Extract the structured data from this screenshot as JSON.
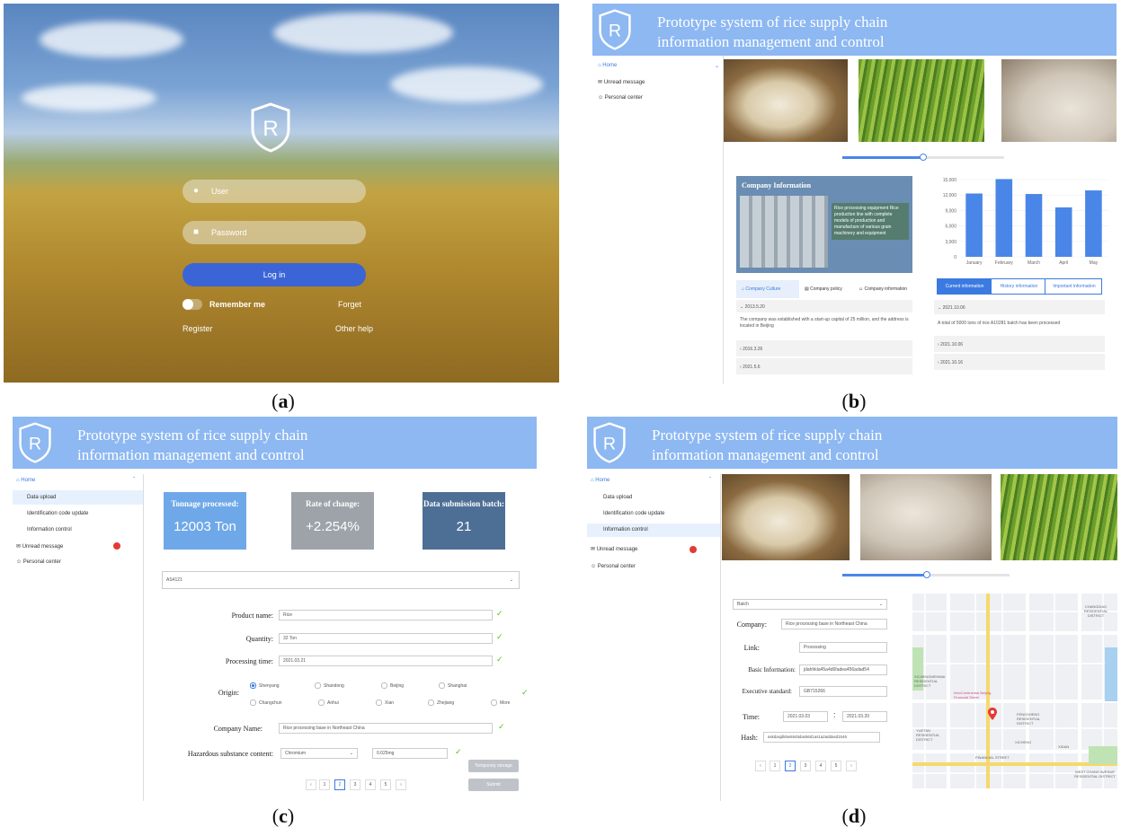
{
  "captions": {
    "a": "a",
    "b": "b",
    "c": "c",
    "d": "d"
  },
  "login": {
    "user_placeholder": "User",
    "password_placeholder": "Password",
    "login_label": "Log in",
    "remember_label": "Remember me",
    "forget_label": "Forget",
    "register_label": "Register",
    "other_help_label": "Other help",
    "logo_letter": "R"
  },
  "header": {
    "line1": "Prototype system of rice supply chain",
    "line2": "information management and control",
    "logo_letter": "R"
  },
  "nav": {
    "home": "Home",
    "unread": "Unread message",
    "personal": "Personal center",
    "data_upload": "Data upload",
    "id_code": "Identification code update",
    "info_control": "Information control"
  },
  "b": {
    "company_title": "Company Information",
    "company_text": "Rice processing equipment Rice production line with complete models of production and manufacture of various grain machinery and equipment",
    "chart_data": {
      "type": "bar",
      "categories": [
        "January",
        "February",
        "March",
        "April",
        "May"
      ],
      "values": [
        12300,
        15100,
        12200,
        9600,
        12900
      ],
      "yticks": [
        "0",
        "3,000",
        "6,000",
        "9,000",
        "12,000",
        "15,000"
      ],
      "ylim": [
        0,
        15000
      ],
      "color": "#4a86e8"
    },
    "tabs_left": [
      "Company Culture",
      "Company policy",
      "Company information"
    ],
    "tabs_right": [
      "Current information",
      "History information",
      "Important information"
    ],
    "acc_left": [
      "2013.5.20",
      "2016.3.26",
      "2021.5.6"
    ],
    "acc_left_text": "The company was established with a start-up capital of 25 million, and the address is located in Beijing",
    "acc_right": [
      "2021.10.06",
      "2021.10.06",
      "2021.10.16"
    ],
    "acc_right_text": "A total of 5000 tons of rice A10281 batch has been processed"
  },
  "c": {
    "stats": [
      {
        "label": "Tonnage processed:",
        "value": "12003 Ton",
        "color": "#6fa8e8"
      },
      {
        "label": "Rate of change:",
        "value": "+2.254%",
        "color": "#9da3a9"
      },
      {
        "label": "Data submission batch:",
        "value": "21",
        "color": "#4d6f96"
      }
    ],
    "batch_select": "AS4121",
    "product_label": "Product name:",
    "product_value": "Rice",
    "quantity_label": "Quantity:",
    "quantity_value": "32 Ton",
    "time_label": "Processing time:",
    "time_value": "2021.03.21",
    "origin_label": "Origin:",
    "origins": [
      "Shenyang",
      "Shandong",
      "Beijing",
      "Shanghai",
      "Changchun",
      "Anhui",
      "Xian",
      "Zhejiang",
      "More"
    ],
    "company_label": "Company Name:",
    "company_value": "Rice processing base in Northeast China",
    "hazard_label": "Hazardous substance content:",
    "hazard_select": "Chromium",
    "hazard_value": "0.025mg",
    "pages": [
      "1",
      "2",
      "3",
      "4",
      "5"
    ],
    "temp_label": "Temporary storage",
    "submit_label": "Submit"
  },
  "d": {
    "batch_select": "Batch",
    "company_label": "Company:",
    "company_value": "Rice processing base in Northeast China",
    "link_label": "Link:",
    "link_value": "Processing",
    "basic_label": "Basic Information:",
    "basic_value": "jdahhkla45a4d6fadea456adad54",
    "exec_label": "Executive standard:",
    "exec_value": "GB715266",
    "time_label": "Time:",
    "time_from": "2021.03.03",
    "time_sep": ":",
    "time_to": "2021.03.20",
    "hash_label": "Hash:",
    "hash_value": "askdasjdklas6545das56d1as1a2addasd1546",
    "pages": [
      "1",
      "2",
      "3",
      "4",
      "5"
    ],
    "map_labels": [
      "CHANGDIAO RESIDENTIAL DISTRICT",
      "XICHENGMENWAI RESIDENTIAL DISTRICT",
      "InterContinental Beijing Financial Street",
      "FENGSHENG RESIDENTIAL DISTRICT",
      "YUETAN RESIDENTIAL DISTRICT",
      "FINANCIAL STREET",
      "XICHENG",
      "XIDAN",
      "WEST CHANG AVENUE RESIDENTIAL DISTRICT"
    ]
  }
}
